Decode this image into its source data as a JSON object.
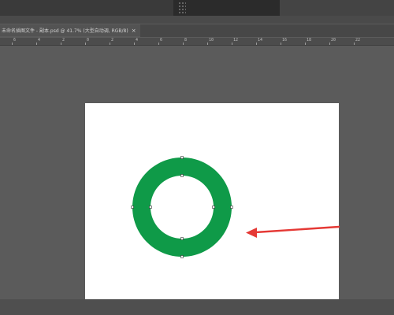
{
  "document_tab": {
    "title": "未命名插图文件 - 副本.psd @ 41.7% (大型自动调, RGB/8)",
    "close_symbol": "×"
  },
  "ruler": {
    "labels": [
      "6",
      "4",
      "2",
      "0",
      "2",
      "4",
      "6",
      "8",
      "10",
      "12",
      "14",
      "16",
      "18",
      "20",
      "22"
    ]
  },
  "shape": {
    "type": "ring",
    "fill_color": "#0f9a48"
  },
  "annotation": {
    "arrow_color": "#e53935",
    "arrow_icon": "red-arrow-icon"
  },
  "colors": {
    "workspace": "#5b5b5b",
    "canvas": "#ffffff"
  }
}
